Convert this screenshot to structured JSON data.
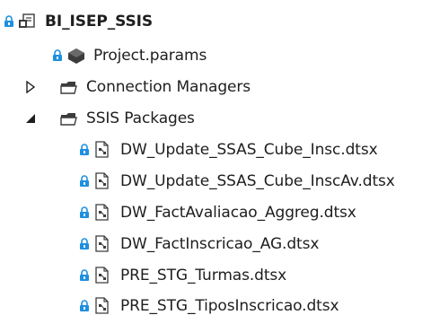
{
  "solution": {
    "name": "BI_ISEP_SSIS"
  },
  "items": [
    {
      "label": "Project.params"
    },
    {
      "label": "Connection Managers"
    },
    {
      "label": "SSIS Packages"
    }
  ],
  "packages": [
    {
      "label": "DW_Update_SSAS_Cube_Insc.dtsx"
    },
    {
      "label": "DW_Update_SSAS_Cube_InscAv.dtsx"
    },
    {
      "label": "DW_FactAvaliacao_Aggreg.dtsx"
    },
    {
      "label": "DW_FactInscricao_AG.dtsx"
    },
    {
      "label": "PRE_STG_Turmas.dtsx"
    },
    {
      "label": "PRE_STG_TiposInscricao.dtsx"
    }
  ],
  "colors": {
    "lock": "#1e90e0",
    "folder": "#3c3c3c",
    "text": "#1e1e1e"
  }
}
